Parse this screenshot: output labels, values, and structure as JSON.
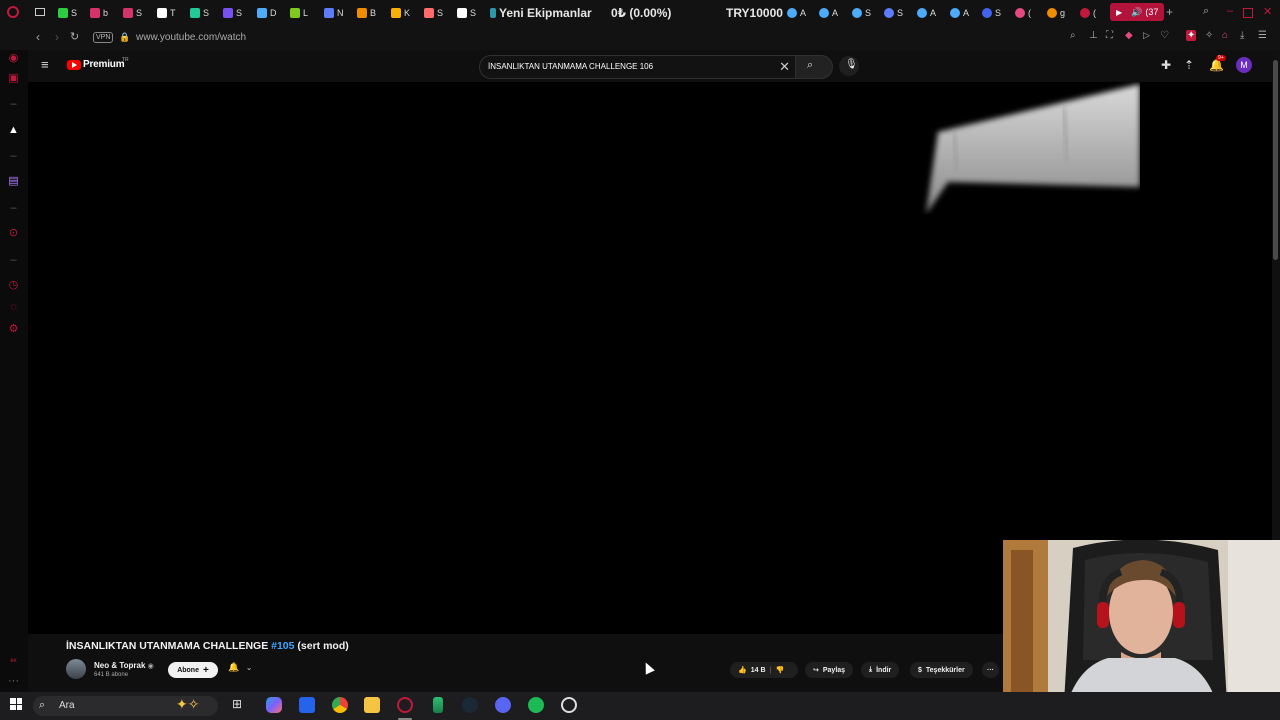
{
  "browser": {
    "tabs": [
      {
        "label": "S",
        "color": "#2ecc40"
      },
      {
        "label": "b",
        "color": "#d6336c"
      },
      {
        "label": "S",
        "color": "#d6336c"
      },
      {
        "label": "T",
        "color": "#ffffff"
      },
      {
        "label": "S",
        "color": "#20c997"
      },
      {
        "label": "S",
        "color": "#7950f2"
      },
      {
        "label": "D",
        "color": "#4dabf7"
      },
      {
        "label": "L",
        "color": "#82c91e"
      },
      {
        "label": "N",
        "color": "#5c7cfa"
      },
      {
        "label": "B",
        "color": "#f08c00"
      },
      {
        "label": "K",
        "color": "#fab005"
      },
      {
        "label": "S",
        "color": "#ff6b6b"
      },
      {
        "label": "S",
        "color": "#ffffff"
      }
    ],
    "ticker_1": "Yeni Ekipmanlar",
    "ticker_2": "0₺ (0.00%)",
    "ticker_3": "TRY10000",
    "tabs_right": [
      "A",
      "A",
      "S",
      "S",
      "A",
      "A",
      "S",
      "(",
      "g",
      "("
    ],
    "audio_tab_count": "(37",
    "url": "www.youtube.com/watch",
    "vpn": "VPN"
  },
  "youtube": {
    "brand": "Premium",
    "region": "TR",
    "search_value": "İNSANLIKTAN UTANMAMA CHALLENGE 106",
    "notif_badge": "9+",
    "avatar_letter": "M"
  },
  "video": {
    "title_main": "İNSANLIKTAN UTANMAMA CHALLENGE ",
    "title_hashtag": "#105",
    "title_suffix": " (sert mod)",
    "channel_name": "Neo & Toprak",
    "channel_subs": "641 B abone",
    "subscribe_label": "Abone",
    "likes": "14 B",
    "share_label": "Paylaş",
    "download_label": "İndir",
    "thanks_label": "Teşekkürler",
    "more": "···"
  },
  "taskbar": {
    "search_label": "Ara"
  }
}
